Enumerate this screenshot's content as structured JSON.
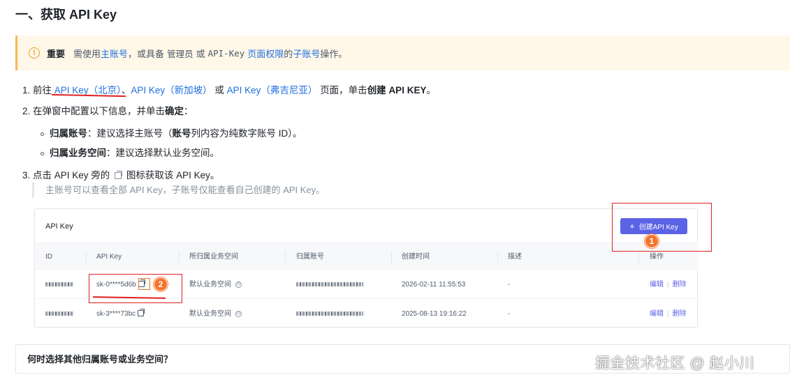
{
  "heading": "一、获取 API Key",
  "notice": {
    "icon": "warning-circle-icon",
    "label": "重要",
    "text1": "需使用",
    "link1": "主账号",
    "text2": "，或具备",
    "code1": "管理员",
    "text3": "或",
    "code2": "API-Key",
    "link2": "页面权限",
    "text4": "的",
    "link3": "子账号",
    "text5": "操作。"
  },
  "steps": {
    "s1": {
      "num": "1.",
      "pre": "前往",
      "link_beijing": "API Key（北京）",
      "sep1": "、",
      "link_singapore": "API Key（新加坡）",
      "or": "或",
      "link_virginia": "API Key（弗吉尼亚）",
      "mid": "页面，单击",
      "bold": "创建 API KEY",
      "end": "。"
    },
    "s2": {
      "num": "2.",
      "pre": "在弹窗中配置以下信息，并单击",
      "bold": "确定",
      "end": "："
    },
    "s2a": {
      "bold": "归属账号",
      "text1": "：建议选择主账号（",
      "bold2": "账号",
      "text2": "列内容为纯数字账号 ID）。"
    },
    "s2b": {
      "bold": "归属业务空间",
      "text": "：建议选择默认业务空间。"
    },
    "s3": {
      "num": "3.",
      "pre": "点击 API Key 旁的",
      "post": "图标获取该 API Key。"
    },
    "note": "主账号可以查看全部 API Key，子账号仅能查看自己创建的 API Key。"
  },
  "panel": {
    "title": "API Key",
    "create_button": "创建API Key",
    "columns": [
      "ID",
      "API Key",
      "所归属业务空间",
      "归属账号",
      "创建时间",
      "描述",
      "操作"
    ],
    "rows": [
      {
        "api_key": "sk-0****5d6b",
        "workspace": "默认业务空间",
        "created": "2026-02-11 11:55:53",
        "desc": "-",
        "edit": "编辑",
        "delete": "删除"
      },
      {
        "api_key": "sk-3****73bc",
        "workspace": "默认业务空间",
        "created": "2025-08-13 19:16:22",
        "desc": "-",
        "edit": "编辑",
        "delete": "删除"
      }
    ]
  },
  "annotations": {
    "badge1": "1",
    "badge2": "2",
    "color": "#e02020",
    "badge_color": "#f5732a"
  },
  "faq": {
    "title": "何时选择其他归属账号或业务空间？"
  },
  "watermark": "掘金技术社区 @ 赵小川",
  "colors": {
    "link": "#1f6fe0",
    "primary_button": "#5b63e6",
    "notice_bg": "#fff7e8",
    "notice_border": "#f7b955"
  }
}
